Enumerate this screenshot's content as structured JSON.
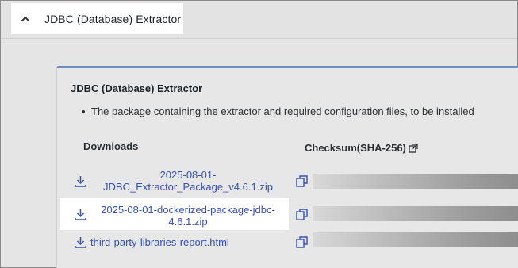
{
  "header": {
    "title": "JDBC (Database) Extractor",
    "chevron_icon": "chevron-up-icon"
  },
  "card": {
    "title": "JDBC (Database) Extractor",
    "bullet": "The package containing the extractor and required configuration files, to be installed"
  },
  "table": {
    "downloads_header": "Downloads",
    "checksum_header": "Checksum(SHA-256)",
    "checksum_header_icon": "external-link-icon",
    "rows": [
      {
        "link_line1": "2025-08-01-",
        "link_line2": "JDBC_Extractor_Package_v4.6.1.zip",
        "download_icon": "download-icon",
        "copy_icon": "copy-icon"
      },
      {
        "link_line1": "2025-08-01-dockerized-package-jdbc-",
        "link_line2": "4.6.1.zip",
        "download_icon": "download-icon",
        "copy_icon": "copy-icon"
      },
      {
        "link_line1": "third-party-libraries-report.html",
        "download_icon": "download-icon",
        "copy_icon": "copy-icon"
      }
    ]
  },
  "colors": {
    "link": "#3651b7",
    "card_accent": "#6d8ebf"
  }
}
